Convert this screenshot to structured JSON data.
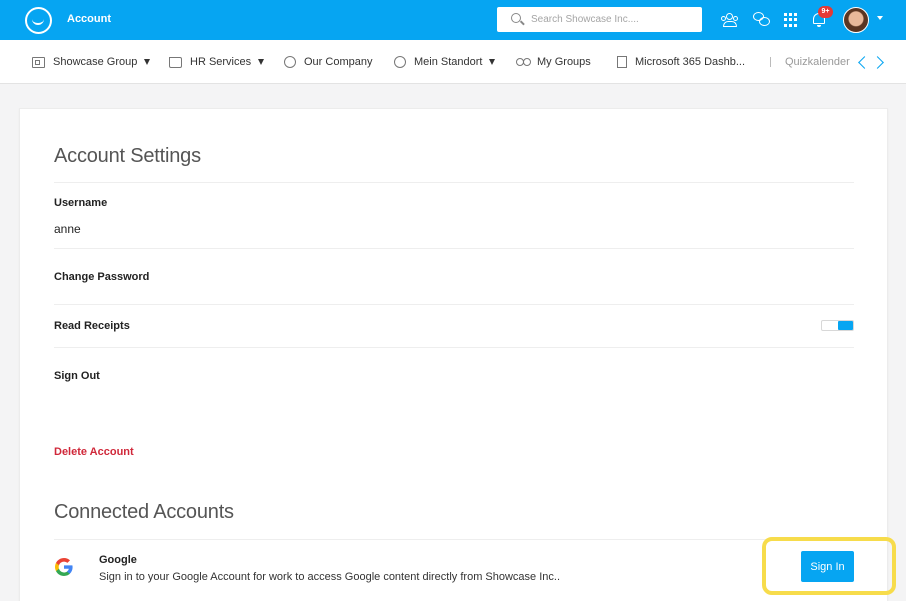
{
  "header": {
    "title": "Account",
    "search_placeholder": "Search Showcase Inc....",
    "notification_badge": "9+",
    "icons": [
      "logo-icon",
      "search-icon",
      "people-icon",
      "chat-icon",
      "apps-grid-icon",
      "bell-icon",
      "avatar"
    ],
    "accent_color": "#06a5f2"
  },
  "nav": {
    "items": [
      {
        "label": "Showcase Group",
        "icon": "building-icon",
        "dropdown": true
      },
      {
        "label": "HR Services",
        "icon": "folder-icon",
        "dropdown": true
      },
      {
        "label": "Our Company",
        "icon": "globe-icon",
        "dropdown": false
      },
      {
        "label": "Mein Standort",
        "icon": "globe-icon",
        "dropdown": true
      },
      {
        "label": "My Groups",
        "icon": "groups-icon",
        "dropdown": false
      },
      {
        "label": "Microsoft 365 Dashb...",
        "icon": "document-icon",
        "dropdown": false
      },
      {
        "label": "Quizkalender",
        "icon": "quiz-icon",
        "dropdown": false
      }
    ]
  },
  "account_settings": {
    "title": "Account Settings",
    "username_label": "Username",
    "username_value": "anne",
    "change_password": "Change Password",
    "read_receipts": "Read Receipts",
    "read_receipts_enabled": true,
    "sign_out": "Sign Out",
    "delete_account": "Delete Account",
    "danger_color": "#d0283a"
  },
  "connected_accounts": {
    "title": "Connected Accounts",
    "google": {
      "name": "Google",
      "description": "Sign in to your Google Account for work to access Google content directly from Showcase Inc..",
      "button": "Sign In"
    }
  }
}
